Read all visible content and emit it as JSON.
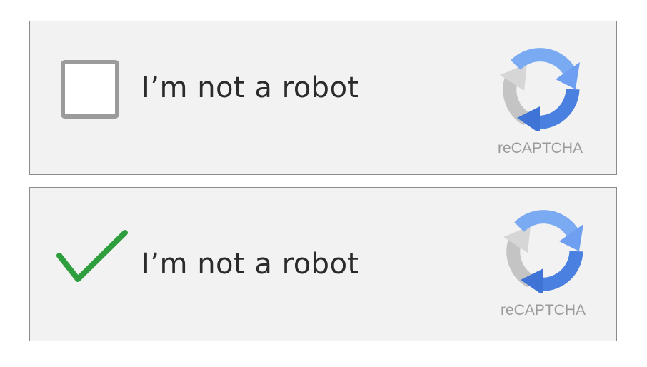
{
  "widgets": [
    {
      "state": "unchecked",
      "label": "I’m not a robot",
      "brand": "reCAPTCHA"
    },
    {
      "state": "checked",
      "label": "I’m not a robot",
      "brand": "reCAPTCHA"
    }
  ],
  "colors": {
    "checkbox_border": "#9b9b9b",
    "checkmark": "#2f9e3f",
    "logo_blue_dark": "#4a80e0",
    "logo_blue_light": "#7aaaf2",
    "logo_gray": "#c4c4c4",
    "brand_text": "#9a9a9a"
  },
  "icons": {
    "logo": "recaptcha-logo-icon",
    "checkmark": "checkmark-icon"
  }
}
